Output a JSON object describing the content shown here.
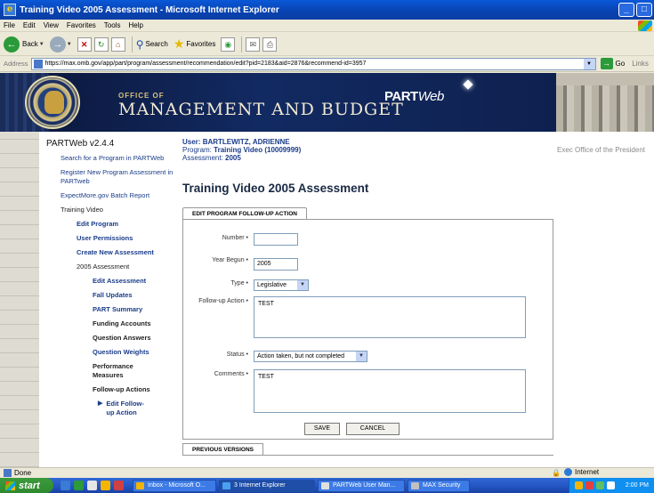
{
  "window": {
    "title": "Training Video 2005 Assessment - Microsoft Internet Explorer"
  },
  "menu": [
    "File",
    "Edit",
    "View",
    "Favorites",
    "Tools",
    "Help"
  ],
  "toolbar": {
    "back_label": "Back",
    "search_label": "Search",
    "favorites_label": "Favorites"
  },
  "addressbar": {
    "label": "Address",
    "url": "https://max.omb.gov/app/part/program/assessment/recommendation/edit?pid=2183&aid=2876&recommend-id=3957",
    "go_label": "Go",
    "links_label": "Links"
  },
  "banner": {
    "office_of": "OFFICE OF",
    "title": "MANAGEMENT AND BUDGET",
    "logo_part": "PART",
    "logo_web": "Web"
  },
  "sidebar": {
    "version": "PARTWeb v2.4.4",
    "items": [
      {
        "label": "Search for a Program in PARTWeb"
      },
      {
        "label": "Register New Program Assessment in PARTweb"
      },
      {
        "label": "ExpectMore.gov Batch Report"
      },
      {
        "label": "Training Video"
      },
      {
        "label": "Edit Program"
      },
      {
        "label": "User Permissions"
      },
      {
        "label": "Create New Assessment"
      },
      {
        "label": "2005 Assessment"
      },
      {
        "label": "Edit Assessment"
      },
      {
        "label": "Fall Updates"
      },
      {
        "label": "PART Summary"
      },
      {
        "label": "Funding Accounts"
      },
      {
        "label": "Question Answers"
      },
      {
        "label": "Question Weights"
      },
      {
        "label": "Performance Measures"
      },
      {
        "label": "Follow-up Actions"
      },
      {
        "label": "Edit Follow-up Action"
      }
    ]
  },
  "header": {
    "user_label": "User:",
    "user_value": "BARTLEWITZ, ADRIENNE",
    "program_label": "Program:",
    "program_value": "Training Video (10009999)",
    "assessment_label": "Assessment:",
    "assessment_value": "2005",
    "exec_office": "Exec Office of the President"
  },
  "main": {
    "page_title": "Training Video 2005 Assessment",
    "panel_tab": "EDIT PROGRAM FOLLOW-UP ACTION",
    "form": {
      "number_label": "Number •",
      "number_value": "",
      "year_label": "Year Begun •",
      "year_value": "2005",
      "type_label": "Type •",
      "type_value": "Legislative",
      "action_label": "Follow-up Action •",
      "action_value": "TEST",
      "status_label": "Status •",
      "status_value": "Action taken, but not completed",
      "comments_label": "Comments •",
      "comments_value": "TEST"
    },
    "save_label": "SAVE",
    "cancel_label": "CANCEL",
    "previous_tab": "PREVIOUS VERSIONS"
  },
  "statusbar": {
    "status": "Done",
    "zone": "Internet"
  },
  "taskbar": {
    "start_label": "start",
    "tasks": [
      {
        "label": "Inbox - Microsoft O..."
      },
      {
        "label": "3 Internet Explorer"
      },
      {
        "label": "PARTWeb User Man..."
      },
      {
        "label": "MAX Security"
      }
    ],
    "clock": "2:00 PM"
  },
  "colors": {
    "link": "#1a3c8a",
    "banner": "#122a62",
    "taskbar": "#2457c4",
    "start": "#2f8a2f"
  }
}
